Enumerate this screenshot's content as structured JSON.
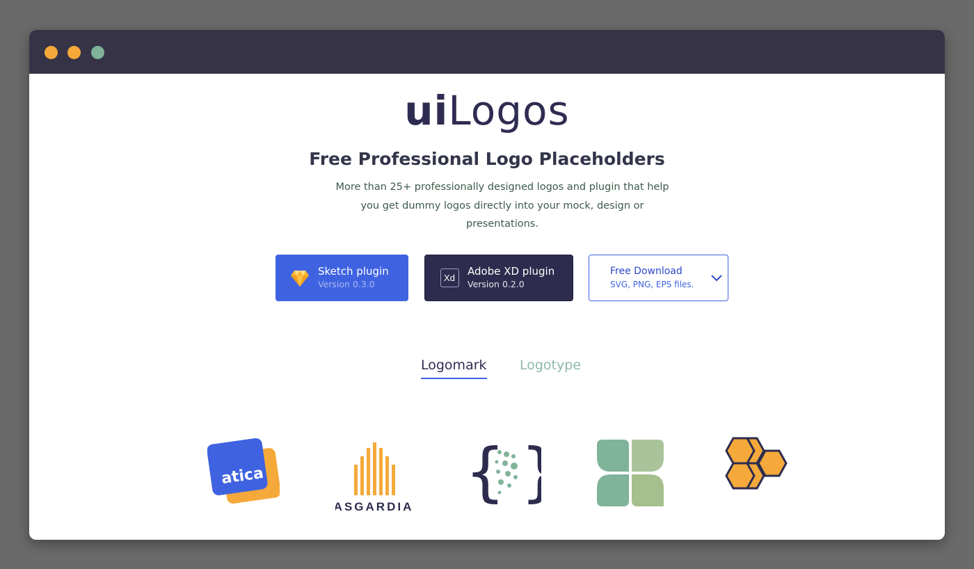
{
  "window": {
    "controls": [
      "close-dot",
      "minimize-dot",
      "maximize-dot"
    ],
    "colors": {
      "titlebar": "#363346",
      "close": "#f5a93a",
      "minimize": "#f5a93a",
      "maximize": "#7fb39a"
    }
  },
  "brand": {
    "part1": "ui",
    "part2": "Logos"
  },
  "hero": {
    "headline": "Free Professional Logo Placeholders",
    "subtext": "More than 25+ professionally designed logos and plugin that help you get dummy logos directly into your mock, design or presentations."
  },
  "buttons": {
    "sketch": {
      "label": "Sketch plugin",
      "version": "Version 0.3.0",
      "icon": "sketch-diamond-icon"
    },
    "xd": {
      "label": "Adobe XD plugin",
      "version": "Version 0.2.0",
      "icon": "adobe-xd-icon",
      "icon_text": "Xd"
    },
    "download": {
      "label": "Free Download",
      "formats": "SVG, PNG, EPS files.",
      "icon": "chevron-down-icon"
    }
  },
  "tabs": [
    {
      "label": "Logomark",
      "active": true
    },
    {
      "label": "Logotype",
      "active": false
    }
  ],
  "logos": [
    {
      "name": "atica",
      "text": "atica"
    },
    {
      "name": "asgardia",
      "text": "ASGARDIA"
    },
    {
      "name": "braces-dots",
      "text": ""
    },
    {
      "name": "leaf-clover",
      "text": ""
    },
    {
      "name": "honeycomb",
      "text": ""
    }
  ],
  "colors": {
    "accent": "#3f63e0",
    "dark": "#2d2c4e",
    "orange": "#f5a93a",
    "green": "#7fb39a"
  }
}
